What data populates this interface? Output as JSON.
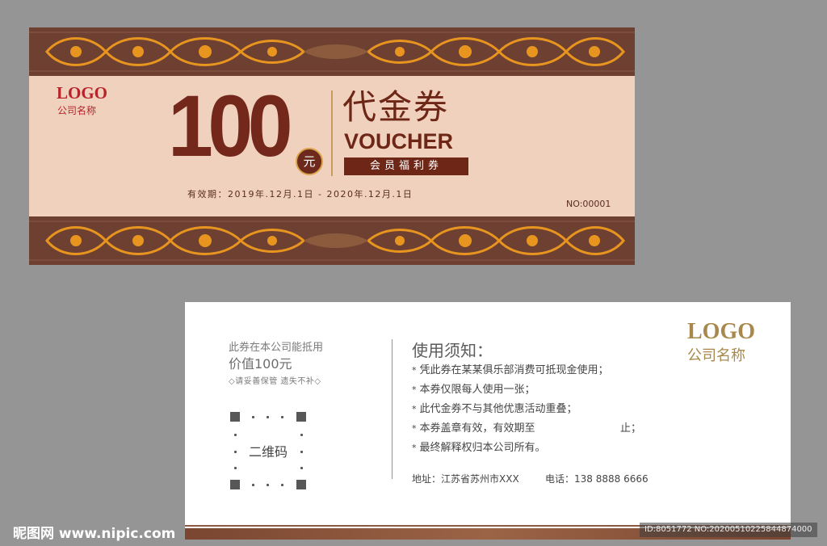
{
  "front": {
    "logo": "LOGO",
    "company": "公司名称",
    "amount": "100",
    "unit": "元",
    "title_cn": "代金券",
    "title_en": "VOUCHER",
    "tag": "会员福利券",
    "validity": "有效期：2019年.12月.1日 - 2020年.12月.1日",
    "serial": "NO:00001"
  },
  "back": {
    "desc_line1": "此券在本公司能抵用",
    "desc_line2": "价值100元",
    "desc_line3": "◇请妥善保管 遗失不补◇",
    "qr_label": "二维码",
    "notice_title": "使用须知：",
    "rules": [
      "凭此券在某某俱乐部消费可抵现金使用；",
      "本券仅限每人使用一张；",
      "此代金券不与其他优惠活动重叠；",
      "本券盖章有效，有效期至",
      "最终解释权归本公司所有。"
    ],
    "rule_bullet": "*",
    "rule4_suffix": "止；",
    "address": "地址：江苏省苏州市XXX",
    "phone": "电话：138 8888 6666",
    "logo": "LOGO",
    "company": "公司名称"
  },
  "watermark": {
    "site": "昵图网 www.nipic.com",
    "id": "ID:8051772 NO:20200510225844874000"
  },
  "colors": {
    "frame_brown": "#6e4032",
    "ornament_gold": "#e8951f",
    "center_peach": "#efd1be",
    "title_brown": "#6e2617",
    "logo_red": "#b6232a",
    "logo_gold": "#a8884b"
  }
}
